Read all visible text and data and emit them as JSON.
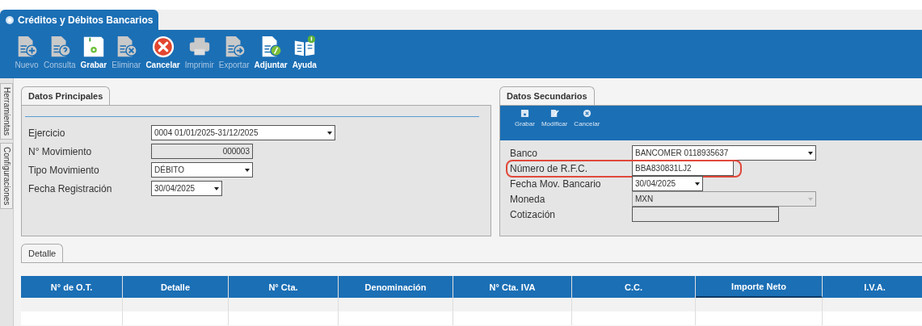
{
  "window": {
    "title": "Créditos y Débitos Bancarios"
  },
  "toolbar": [
    {
      "label": "Nuevo",
      "kind": "new",
      "disabled": true
    },
    {
      "label": "Consulta",
      "kind": "query",
      "disabled": true
    },
    {
      "label": "Grabar",
      "kind": "save",
      "disabled": false
    },
    {
      "label": "Eliminar",
      "kind": "delete",
      "disabled": true
    },
    {
      "label": "Cancelar",
      "kind": "cancel",
      "disabled": false
    },
    {
      "label": "Imprimir",
      "kind": "print",
      "disabled": true
    },
    {
      "label": "Exportar",
      "kind": "export",
      "disabled": true
    },
    {
      "label": "Adjuntar",
      "kind": "attach",
      "disabled": false
    },
    {
      "label": "Ayuda",
      "kind": "help",
      "disabled": false
    }
  ],
  "side_tabs": [
    {
      "label": "Herramientas"
    },
    {
      "label": "Configuraciones"
    }
  ],
  "principal": {
    "tab": "Datos Principales",
    "fields": [
      {
        "label": "Ejercicio",
        "value": "0004 01/01/2025-31/12/2025",
        "kind": "dropdown"
      },
      {
        "label": "N° Movimiento",
        "value": "000003",
        "kind": "readonly"
      },
      {
        "label": "Tipo Movimiento",
        "value": "DÉBITO",
        "kind": "dropdown"
      },
      {
        "label": "Fecha Registración",
        "value": "30/04/2025",
        "kind": "dropdown"
      }
    ]
  },
  "secundarios": {
    "tab": "Datos Secundarios",
    "toolbar": [
      {
        "label": "Grabar",
        "kind": "save"
      },
      {
        "label": "Modificar",
        "kind": "edit"
      },
      {
        "label": "Cancelar",
        "kind": "cancel"
      }
    ],
    "fields": [
      {
        "label": "Banco",
        "value": "BANCOMER 0118935637",
        "kind": "dropdown",
        "highlighted": false
      },
      {
        "label": "Número de R.F.C.",
        "value": "BBA830831LJ2",
        "kind": "text",
        "highlighted": true
      },
      {
        "label": "Fecha Mov. Bancario",
        "value": "30/04/2025",
        "kind": "dropdown",
        "highlighted": false
      },
      {
        "label": "Moneda",
        "value": "MXN",
        "kind": "disabled",
        "highlighted": false
      },
      {
        "label": "Cotización",
        "kind": "readonly",
        "highlighted": false
      }
    ]
  },
  "detalle": {
    "tab": "Detalle",
    "columns": [
      {
        "label": "N° de O.T.",
        "selected": false
      },
      {
        "label": "Detalle",
        "selected": false
      },
      {
        "label": "N° Cta.",
        "selected": false
      },
      {
        "label": "Denominación",
        "selected": false
      },
      {
        "label": "N° Cta. IVA",
        "selected": false
      },
      {
        "label": "C.C.",
        "selected": false
      },
      {
        "label": "Importe Neto",
        "selected": true
      },
      {
        "label": "I.V.A.",
        "selected": false
      }
    ]
  }
}
